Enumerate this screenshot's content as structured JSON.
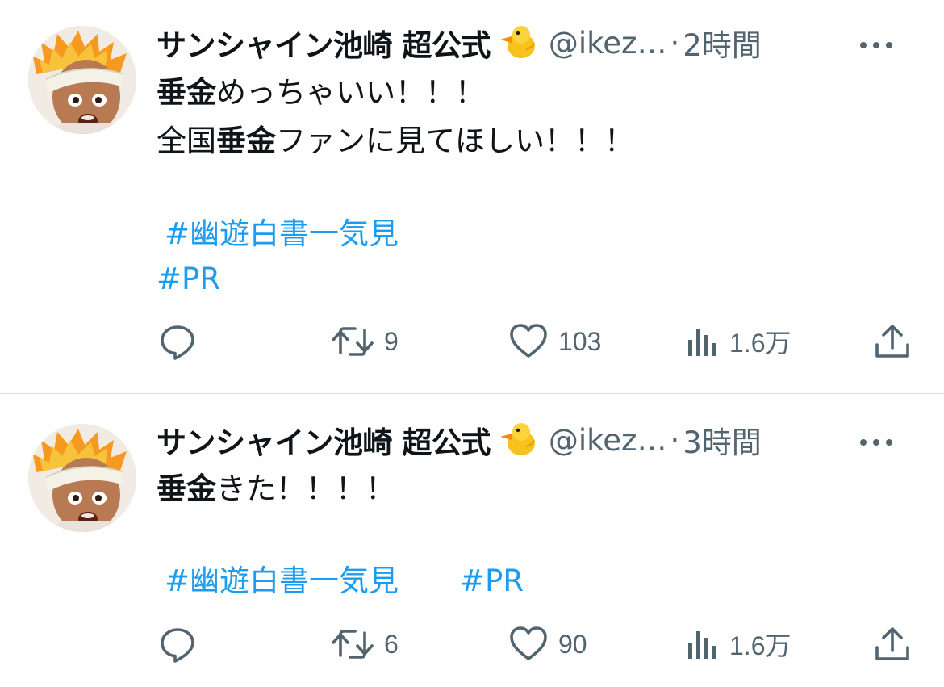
{
  "tweets": [
    {
      "author_name": "サンシャイン池崎 超公式",
      "handle": "@ikez…",
      "separator": "·",
      "time": "2時間",
      "text_line1_bold": "垂金",
      "text_line1_rest": "めっちゃいい！！！",
      "text_line2_prefix": "全国",
      "text_line2_bold": "垂金",
      "text_line2_rest": "ファンに見てほしい！！！",
      "hashtag1": "#幽遊白書一気見",
      "hashtag2": "#PR",
      "reply_count": "",
      "retweet_count": "9",
      "like_count": "103",
      "view_count": "1.6万"
    },
    {
      "author_name": "サンシャイン池崎 超公式",
      "handle": "@ikez…",
      "separator": "·",
      "time": "3時間",
      "text_line1_bold": "垂金",
      "text_line1_rest": "きた！！！！",
      "hashtag1": "#幽遊白書一気見",
      "hashtag2": "#PR",
      "reply_count": "",
      "retweet_count": "6",
      "like_count": "90",
      "view_count": "1.6万"
    }
  ],
  "icons": {
    "reply": "reply-icon",
    "retweet": "retweet-icon",
    "like": "heart-icon",
    "views": "views-icon",
    "share": "share-icon",
    "more": "more-icon",
    "badge": "chick-emoji-icon"
  },
  "colors": {
    "text": "#0f1419",
    "secondary": "#536471",
    "link": "#1d9bf0",
    "divider": "#dbe0e4"
  }
}
